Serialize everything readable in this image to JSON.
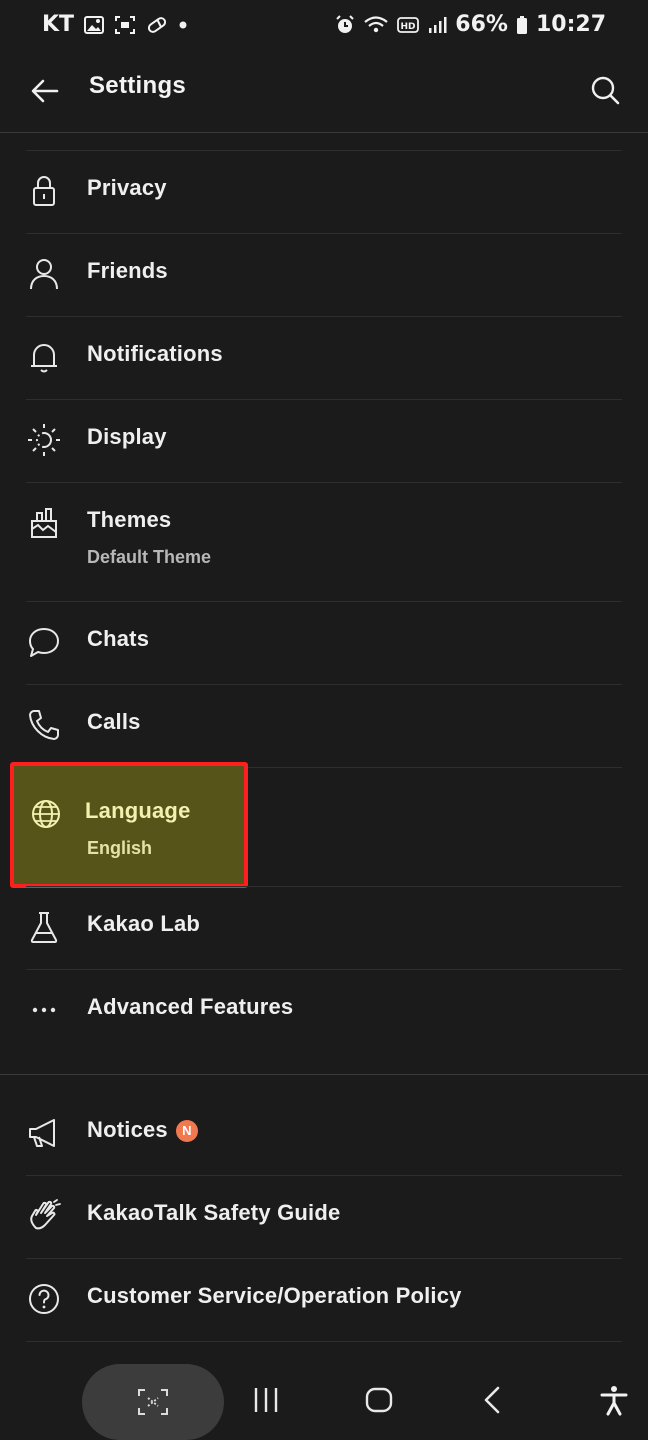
{
  "status_bar": {
    "carrier": "KT",
    "battery": "66%",
    "time": "10:27"
  },
  "app_bar": {
    "title": "Settings"
  },
  "settings": {
    "items": [
      {
        "label": "Privacy",
        "icon": "lock-icon"
      },
      {
        "label": "Friends",
        "icon": "person-icon"
      },
      {
        "label": "Notifications",
        "icon": "bell-icon"
      },
      {
        "label": "Display",
        "icon": "brightness-icon"
      },
      {
        "label": "Themes",
        "sub": "Default Theme",
        "icon": "brush-icon"
      },
      {
        "label": "Chats",
        "icon": "chat-bubble-icon"
      },
      {
        "label": "Calls",
        "icon": "phone-icon"
      },
      {
        "label": "Language",
        "sub": "English",
        "icon": "globe-icon",
        "highlighted": true
      },
      {
        "label": "Kakao Lab",
        "icon": "flask-icon"
      },
      {
        "label": "Advanced Features",
        "icon": "more-dots-icon"
      }
    ],
    "support_items": [
      {
        "label": "Notices",
        "badge": "N",
        "icon": "megaphone-icon"
      },
      {
        "label": "KakaoTalk Safety Guide",
        "icon": "hand-icon"
      },
      {
        "label": "Customer Service/Operation Policy",
        "icon": "help-circle-icon"
      }
    ]
  },
  "colors": {
    "background": "#1b1b1b",
    "highlight_fill": "#565419",
    "highlight_border": "#ff1f1f",
    "badge": "#f2784f"
  }
}
